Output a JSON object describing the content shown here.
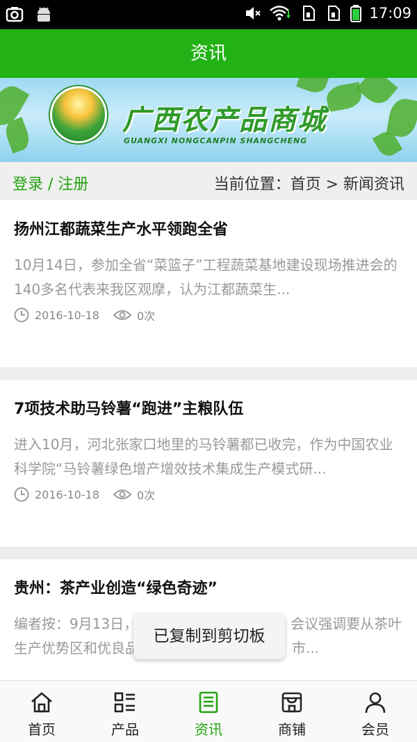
{
  "status_bar": {
    "time": "17:09"
  },
  "header": {
    "title": "资讯"
  },
  "banner": {
    "title": "广西农产品商城",
    "subtitle": "GUANGXI   NONGCANPIN   SHANGCHENG"
  },
  "location": {
    "login": "登录 / 注册",
    "breadcrumb": "当前位置：首页 > 新闻资讯"
  },
  "articles": [
    {
      "title": "扬州江都蔬菜生产水平领跑全省",
      "summary": "10月14日，参加全省“菜篮子”工程蔬菜基地建设现场推进会的140多名代表来我区观摩，认为江都蔬菜生...",
      "date": "2016-10-18",
      "views": "0次"
    },
    {
      "title": "7项技术助马铃薯“跑进”主粮队伍",
      "summary": "进入10月，河北张家口地里的马铃薯都已收完，作为中国农业科学院“马铃薯绿色增产增效技术集成生产模式研...",
      "date": "2016-10-18",
      "views": "0次"
    },
    {
      "title": "贵州：茶产业创造“绿色奇迹”",
      "summary": "编者按：9月13日，农业部召开部常务会议，会议强调要从茶叶生产优势区和优良品种，绿色生态安全生产，市...",
      "date": "",
      "views": ""
    }
  ],
  "toast": {
    "text": "已复制到剪切板"
  },
  "tabbar": {
    "tabs": [
      {
        "label": "首页"
      },
      {
        "label": "产品"
      },
      {
        "label": "资讯"
      },
      {
        "label": "商铺"
      },
      {
        "label": "会员"
      }
    ]
  },
  "colors": {
    "brand_green": "#22b215",
    "active_green": "#22a30f",
    "muted_text": "#999999"
  }
}
